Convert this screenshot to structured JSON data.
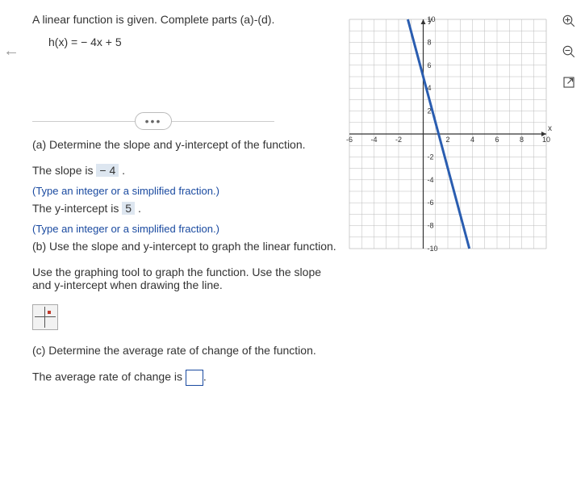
{
  "problem": {
    "prompt": "A linear function is given. Complete parts (a)-(d).",
    "equation": "h(x) = − 4x + 5"
  },
  "parts": {
    "a": {
      "question": "(a) Determine the slope and y-intercept of the function.",
      "slope_label": "The slope is ",
      "slope_value": "− 4",
      "period": ".",
      "instruction": "(Type an integer or a simplified fraction.)",
      "yint_label": "The y-intercept is ",
      "yint_value": "5"
    },
    "b": {
      "question": "(b) Use the slope and y-intercept to graph the linear function.",
      "hint": "Use the graphing tool to graph the function. Use the slope and y-intercept when drawing the line."
    },
    "c": {
      "question": "(c) Determine the average rate of change of the function.",
      "answer_label": "The average rate of change is "
    }
  },
  "axes": {
    "x_label": "x",
    "y_label": "y"
  },
  "ticks": {
    "x": [
      "-6",
      "-4",
      "-2",
      "2",
      "4",
      "6",
      "8",
      "10"
    ],
    "y": [
      "10",
      "8",
      "6",
      "4",
      "2",
      "-2",
      "-4",
      "-6",
      "-8",
      "-10"
    ]
  },
  "chart_data": {
    "type": "line",
    "title": "",
    "xlabel": "x",
    "ylabel": "y",
    "xlim": [
      -6,
      10
    ],
    "ylim": [
      -10,
      10
    ],
    "grid": true,
    "series": [
      {
        "name": "h(x) = -4x + 5",
        "x": [
          -1.25,
          3.75
        ],
        "y": [
          10,
          -10
        ]
      }
    ]
  }
}
